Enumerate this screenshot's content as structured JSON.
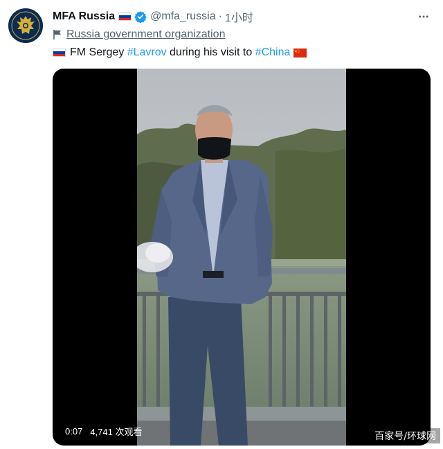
{
  "tweet": {
    "display_name": "MFA Russia",
    "handle": "@mfa_russia",
    "separator": "·",
    "time": "1小时",
    "label": "Russia government organization",
    "text": {
      "prefix": "FM Sergey ",
      "hashtag1": "#Lavrov",
      "middle": " during his visit to ",
      "hashtag2": "#China"
    }
  },
  "video": {
    "duration": "0:07",
    "views": "4,741 次观看"
  },
  "watermark": "百家号/环球网",
  "colors": {
    "link": "#1d9bf0",
    "secondary_text": "#536471",
    "verified": "#1d9bf0"
  },
  "icons": [
    "verified-badge-icon",
    "more-options-icon",
    "government-flag-icon",
    "russia-flag-icon",
    "china-flag-icon",
    "coat-of-arms-logo"
  ]
}
